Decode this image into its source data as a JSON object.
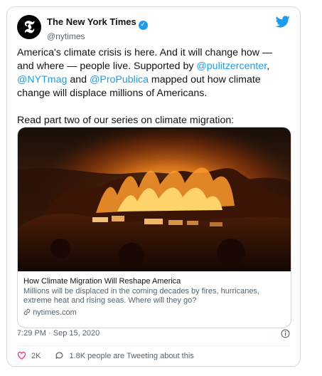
{
  "account": {
    "display_name": "The New York Times",
    "handle": "@nytimes",
    "avatar_letter": "𝕿"
  },
  "tweet": {
    "line1_pre": "America's climate crisis is here. And it will change how — and where  — people live. Supported by ",
    "mention1": "@pulitzercenter",
    "sep1": ", ",
    "mention2": "@NYTmag",
    "sep2": " and ",
    "mention3": "@ProPublica",
    "line1_post": " mapped out how climate change will displace millions of Americans.",
    "line2": "Read part two of our series on climate migration:"
  },
  "link_card": {
    "title": "How Climate Migration Will Reshape America",
    "description": "Millions will be displaced in the coming decades by fires, hurricanes, extreme heat and rising seas. Where will they go?",
    "domain": "nytimes.com"
  },
  "meta": {
    "timestamp": "7:29 PM · Sep 15, 2020"
  },
  "actions": {
    "likes": "2K",
    "tweeting": "1.8K people are Tweeting about this"
  },
  "colors": {
    "accent": "#1d9bf0",
    "like_pink": "#f91880",
    "secondary_text": "#536471"
  },
  "icons": [
    "twitter-bird-icon",
    "verified-badge-icon",
    "link-icon",
    "info-icon",
    "heart-icon",
    "comment-icon"
  ]
}
